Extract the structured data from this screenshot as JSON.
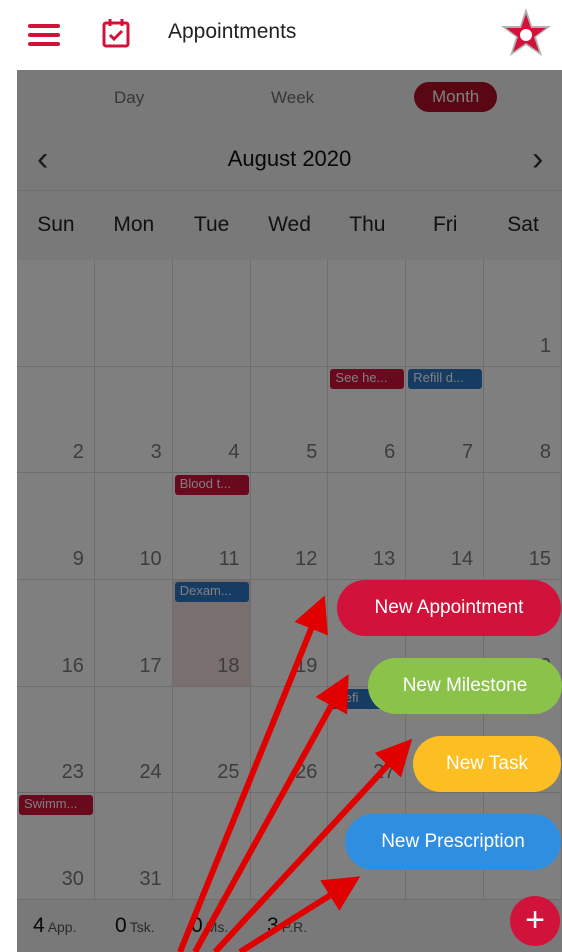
{
  "header": {
    "title": "Appointments",
    "menu_icon": "hamburger-icon",
    "calendar_icon": "calendar-check-icon",
    "logo_icon": "star-logo-icon"
  },
  "view_tabs": {
    "day": "Day",
    "week": "Week",
    "month": "Month",
    "active": "month"
  },
  "calendar": {
    "month_title": "August 2020",
    "prev_icon": "chevron-left-icon",
    "next_icon": "chevron-right-icon",
    "weekdays": [
      "Sun",
      "Mon",
      "Tue",
      "Wed",
      "Thu",
      "Fri",
      "Sat"
    ],
    "weeks": [
      [
        "",
        "",
        "",
        "",
        "",
        "",
        "1"
      ],
      [
        "2",
        "3",
        "4",
        "5",
        "6",
        "7",
        "8"
      ],
      [
        "9",
        "10",
        "11",
        "12",
        "13",
        "14",
        "15"
      ],
      [
        "16",
        "17",
        "18",
        "19",
        "",
        "",
        "22"
      ],
      [
        "23",
        "24",
        "25",
        "26",
        "27",
        "",
        ""
      ],
      [
        "30",
        "31",
        "",
        "",
        "",
        "",
        ""
      ]
    ],
    "events": [
      {
        "label": "See he...",
        "week": 1,
        "day": 4,
        "color": "red"
      },
      {
        "label": "Refill d...",
        "week": 1,
        "day": 5,
        "color": "blue"
      },
      {
        "label": "Blood t...",
        "week": 2,
        "day": 2,
        "color": "red"
      },
      {
        "label": "Dexam...",
        "week": 3,
        "day": 2,
        "color": "blue"
      },
      {
        "label": "Refi",
        "week": 4,
        "day": 4,
        "color": "blue"
      },
      {
        "label": "Swimm...",
        "week": 5,
        "day": 0,
        "color": "red"
      }
    ]
  },
  "summary": {
    "appointments_count": "4",
    "appointments_label": "App.",
    "tasks_count": "0",
    "tasks_label": "Tsk.",
    "milestones_count": "0",
    "milestones_label": "Ms.",
    "prescriptions_count": "3",
    "prescriptions_label": "P.R."
  },
  "fab_menu": {
    "new_appointment": "New Appointment",
    "new_milestone": "New Milestone",
    "new_task": "New Task",
    "new_prescription": "New Prescription",
    "add_button": "+"
  },
  "colors": {
    "brand_red": "#d1133b",
    "event_blue": "#2f78c8",
    "milestone_green": "#8bc34a",
    "task_yellow": "#fbbf24",
    "prescription_blue": "#2f8ee0",
    "annotation_arrow": "#e00000"
  }
}
